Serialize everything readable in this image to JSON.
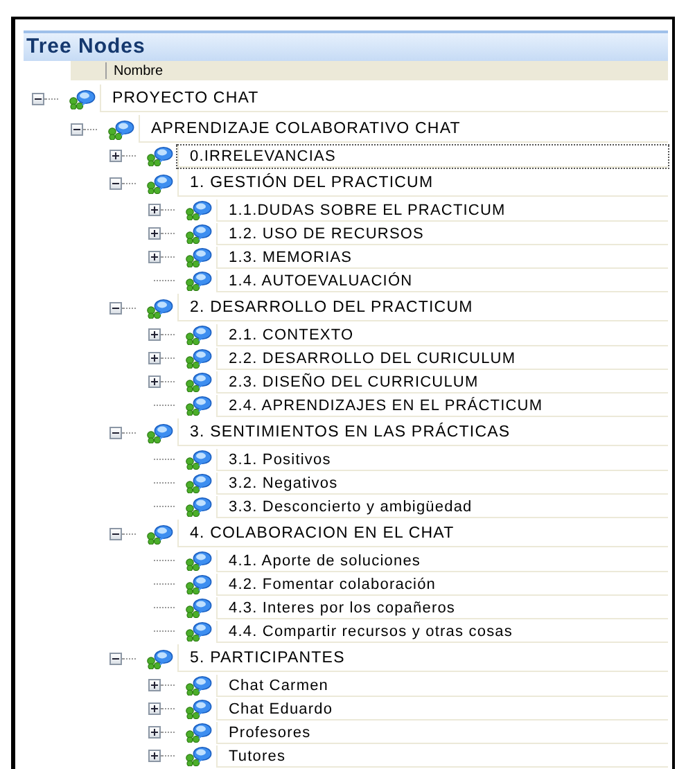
{
  "panel": {
    "title": "Tree Nodes"
  },
  "table": {
    "columns": [
      "Nombre"
    ]
  },
  "tree": [
    {
      "label": "PROYECTO CHAT",
      "expanded": true,
      "children": [
        {
          "label": "APRENDIZAJE COLABORATIVO CHAT",
          "expanded": true,
          "children": [
            {
              "label": "0.IRRELEVANCIAS",
              "expanded": false
            },
            {
              "label": "1. GESTIÓN DEL PRACTICUM",
              "expanded": true,
              "children": [
                {
                  "label": "1.1.DUDAS SOBRE EL PRACTICUM",
                  "expanded": false
                },
                {
                  "label": "1.2. USO DE RECURSOS",
                  "expanded": false
                },
                {
                  "label": "1.3. MEMORIAS",
                  "expanded": false
                },
                {
                  "label": "1.4. AUTOEVALUACIÓN"
                }
              ]
            },
            {
              "label": "2. DESARROLLO DEL PRACTICUM",
              "expanded": true,
              "children": [
                {
                  "label": "2.1. CONTEXTO",
                  "expanded": false
                },
                {
                  "label": "2.2. DESARROLLO DEL CURICULUM",
                  "expanded": false
                },
                {
                  "label": "2.3. DISEÑO DEL CURRICULUM",
                  "expanded": false
                },
                {
                  "label": "2.4. APRENDIZAJES EN EL PRÁCTICUM"
                }
              ]
            },
            {
              "label": "3. SENTIMIENTOS EN LAS PRÁCTICAS",
              "expanded": true,
              "children": [
                {
                  "label": "3.1. Positivos"
                },
                {
                  "label": "3.2. Negativos"
                },
                {
                  "label": "3.3. Desconcierto y ambigüedad"
                }
              ]
            },
            {
              "label": "4. COLABORACION EN EL CHAT",
              "expanded": true,
              "children": [
                {
                  "label": "4.1. Aporte de soluciones"
                },
                {
                  "label": "4.2. Fomentar colaboración"
                },
                {
                  "label": "4.3. Interes por los copañeros"
                },
                {
                  "label": "4.4. Compartir recursos y otras cosas"
                }
              ]
            },
            {
              "label": "5. PARTICIPANTES",
              "expanded": true,
              "children": [
                {
                  "label": "Chat Carmen",
                  "expanded": false
                },
                {
                  "label": "Chat Eduardo",
                  "expanded": false
                },
                {
                  "label": "Profesores",
                  "expanded": false
                },
                {
                  "label": "Tutores",
                  "expanded": false
                }
              ]
            }
          ]
        }
      ]
    }
  ]
}
